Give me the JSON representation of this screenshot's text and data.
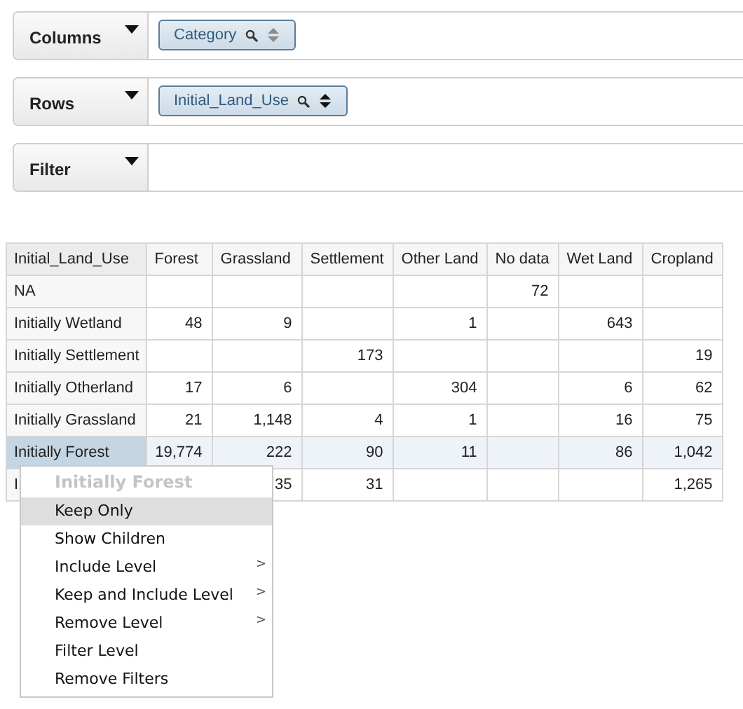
{
  "shelves": [
    {
      "label": "Columns",
      "pills": [
        {
          "label": "Category",
          "sort_active": false
        }
      ]
    },
    {
      "label": "Rows",
      "pills": [
        {
          "label": "Initial_Land_Use",
          "sort_active": true
        }
      ]
    },
    {
      "label": "Filter"
    }
  ],
  "table": {
    "columns": [
      "Initial_Land_Use",
      "Forest",
      "Grassland",
      "Settlement",
      "Other Land",
      "No data",
      "Wet Land",
      "Cropland"
    ],
    "rows": [
      {
        "cells": [
          "NA",
          "",
          "",
          "",
          "",
          "72",
          "",
          ""
        ],
        "selected": false
      },
      {
        "cells": [
          "Initially Wetland",
          "48",
          "9",
          "",
          "1",
          "",
          "643",
          ""
        ],
        "selected": false
      },
      {
        "cells": [
          "Initially Settlement",
          "",
          "",
          "173",
          "",
          "",
          "",
          "19"
        ],
        "selected": false
      },
      {
        "cells": [
          "Initially Otherland",
          "17",
          "6",
          "",
          "304",
          "",
          "6",
          "62"
        ],
        "selected": false
      },
      {
        "cells": [
          "Initially Grassland",
          "21",
          "1,148",
          "4",
          "1",
          "",
          "16",
          "75"
        ],
        "selected": false
      },
      {
        "cells": [
          "Initially Forest",
          "19,774",
          "222",
          "90",
          "11",
          "",
          "86",
          "1,042"
        ],
        "selected": true
      },
      {
        "cells": [
          "I",
          "",
          "35",
          "31",
          "",
          "",
          "",
          "1,265"
        ],
        "selected": false
      }
    ]
  },
  "context_menu": {
    "title": "Initially Forest",
    "items": [
      {
        "label": "Keep Only",
        "selected": true
      },
      {
        "label": "Show Children",
        "selected": false
      },
      {
        "label": "Include Level",
        "selected": false,
        "submenu_mark": ">"
      },
      {
        "label": "Keep and Include Level",
        "selected": false,
        "submenu_mark": ">"
      },
      {
        "label": "Remove Level",
        "selected": false,
        "submenu_mark": ">"
      },
      {
        "label": "Filter Level",
        "selected": false
      },
      {
        "label": "Remove Filters",
        "selected": false
      }
    ]
  }
}
